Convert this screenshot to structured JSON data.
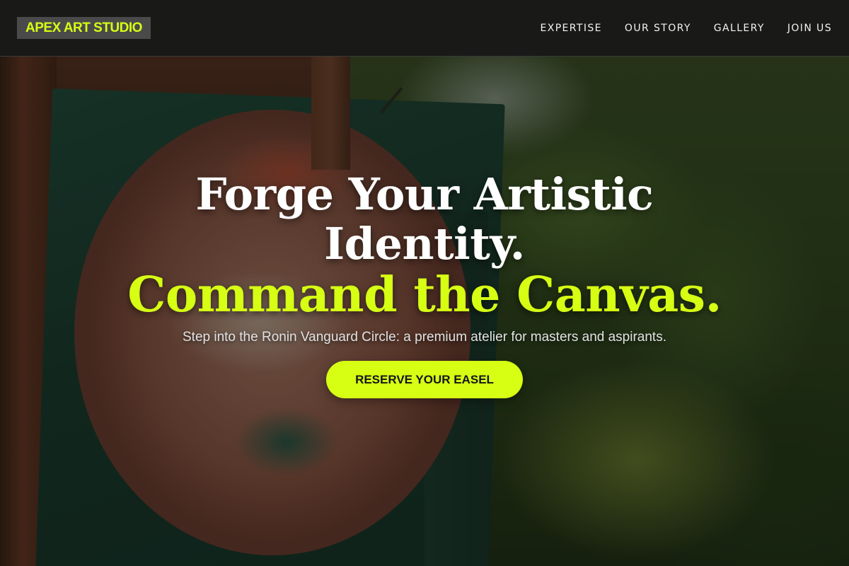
{
  "nav": {
    "logo": "APEX ART STUDIO",
    "links": [
      {
        "label": "EXPERTISE"
      },
      {
        "label": "OUR STORY"
      },
      {
        "label": "GALLERY"
      },
      {
        "label": "JOIN US"
      }
    ]
  },
  "hero": {
    "headline_line1": "Forge Your Artistic",
    "headline_line2": "Identity.",
    "headline_accent": "Command the Canvas.",
    "subheadline": "Step into the Ronin Vanguard Circle: a premium atelier for masters and aspirants.",
    "cta_label": "RESERVE YOUR EASEL"
  },
  "colors": {
    "accent": "#d6ff14",
    "navbar_bg": "#181818",
    "logo_bg": "#4a4a4a",
    "text_primary": "#ffffff"
  }
}
